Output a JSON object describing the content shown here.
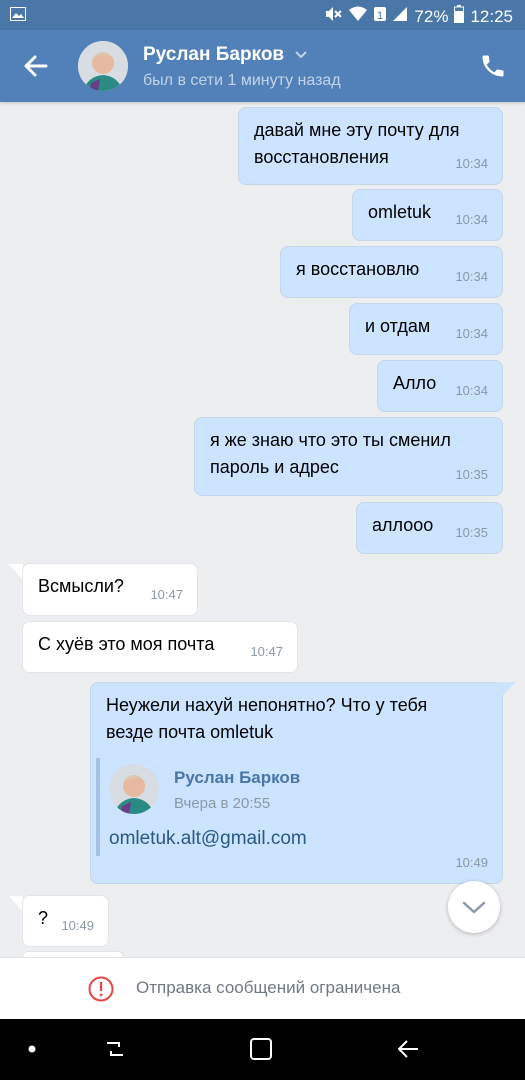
{
  "status_bar": {
    "battery": "72%",
    "time": "12:25",
    "icons": [
      "image-icon",
      "mute-icon",
      "wifi-icon",
      "sim-icon",
      "signal-icon",
      "battery-icon"
    ]
  },
  "header": {
    "contact_name": "Руслан Барков",
    "status": "был в сети 1 минуту назад",
    "icons": [
      "back-arrow-icon",
      "chevron-down-icon",
      "phone-icon"
    ]
  },
  "messages": [
    {
      "dir": "out",
      "line1": "давай мне эту почту для",
      "line2": "восстановления",
      "time": "10:34"
    },
    {
      "dir": "out",
      "text": "omletuk",
      "time": "10:34"
    },
    {
      "dir": "out",
      "text": "я восстановлю",
      "time": "10:34"
    },
    {
      "dir": "out",
      "text": "и отдам",
      "time": "10:34"
    },
    {
      "dir": "out",
      "text": "Алло",
      "time": "10:34"
    },
    {
      "dir": "out",
      "line1": "я же знаю что это ты сменил",
      "line2": "пароль и адрес",
      "time": "10:35"
    },
    {
      "dir": "out",
      "text": "аллооо",
      "time": "10:35"
    },
    {
      "dir": "in",
      "text": "Всмысли?",
      "time": "10:47"
    },
    {
      "dir": "in",
      "text": "С хуёв это моя почта",
      "time": "10:47"
    },
    {
      "dir": "out",
      "line1": "Неужели нахуй непонятно? Что у тебя",
      "line2": "везде почта omletuk",
      "time": "10:49",
      "forwarded": {
        "name": "Руслан Барков",
        "date": "Вчера в 20:55",
        "text": "omletuk.alt@gmail.com"
      }
    },
    {
      "dir": "in",
      "text": "?",
      "time": "10:49"
    }
  ],
  "restricted_notice": "Отправка сообщений ограничена",
  "colors": {
    "header": "#5181b8",
    "statusbar": "#4a76a8",
    "outgoing_bubble": "#cce4ff",
    "incoming_bubble": "#ffffff",
    "background": "#edeef0",
    "link": "#2a5885",
    "warning": "#e64646"
  }
}
